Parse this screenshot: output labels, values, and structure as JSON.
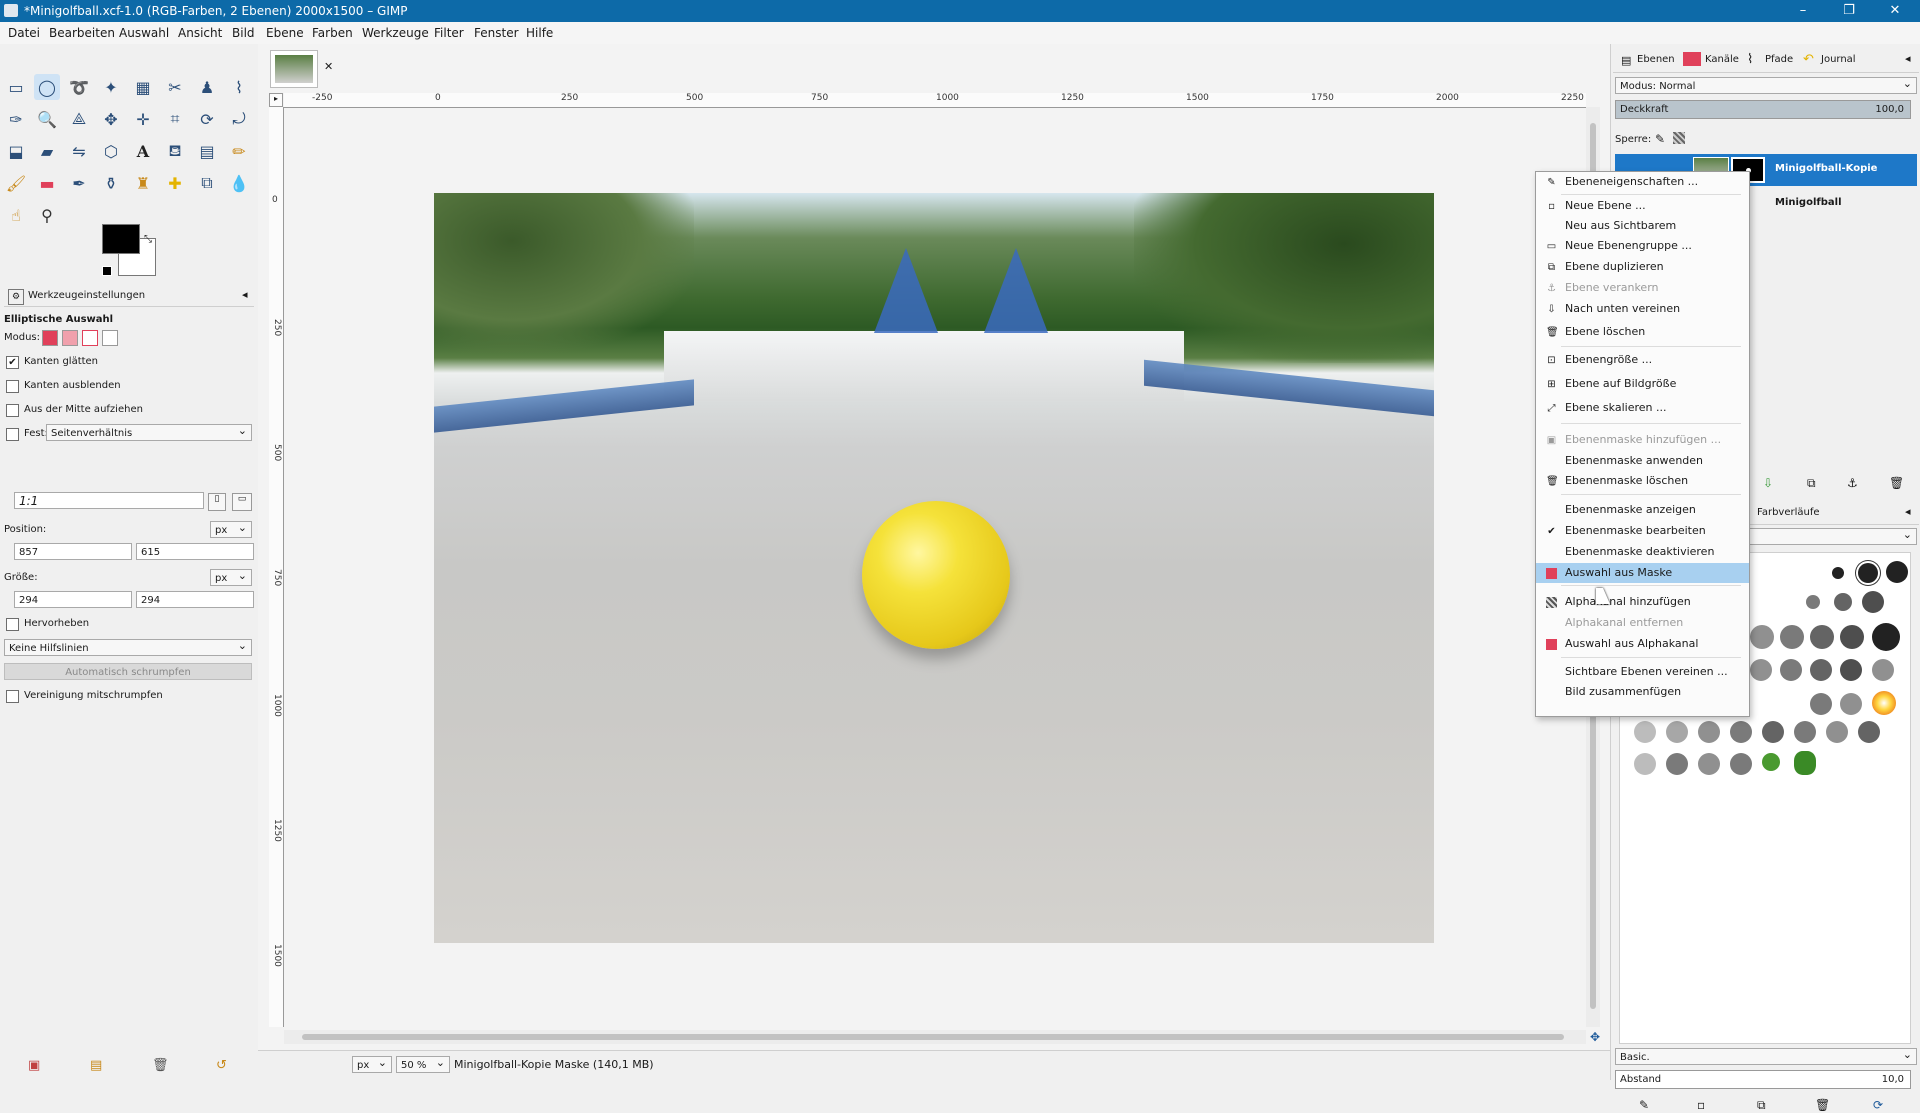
{
  "window": {
    "title": "*Minigolfball.xcf-1.0 (RGB-Farben, 2 Ebenen) 2000x1500 – GIMP",
    "controls": [
      "–",
      "❐",
      "✕"
    ]
  },
  "menubar": [
    "Datei",
    "Bearbeiten",
    "Auswahl",
    "Ansicht",
    "Bild",
    "Ebene",
    "Farben",
    "Werkzeuge",
    "Filter",
    "Fenster",
    "Hilfe"
  ],
  "tool_options": {
    "tab_label": "Werkzeugeinstellungen",
    "tool_name": "Elliptische Auswahl",
    "mode_label": "Modus:",
    "antialias": "Kanten glätten",
    "feather": "Kanten ausblenden",
    "from_center": "Aus der Mitte aufziehen",
    "fixed": "Fest:",
    "fixed_value": "Seitenverhältnis",
    "ratio": "1:1",
    "position_label": "Position:",
    "position_unit": "px",
    "pos_x": "857",
    "pos_y": "615",
    "size_label": "Größe:",
    "size_unit": "px",
    "size_w": "294",
    "size_h": "294",
    "highlight": "Hervorheben",
    "guides": "Keine Hilfslinien",
    "auto_shrink": "Automatisch schrumpfen",
    "shrink_merged": "Vereinigung mitschrumpfen"
  },
  "ruler": {
    "h_ticks": [
      "-250",
      "0",
      "250",
      "500",
      "750",
      "1000",
      "1250",
      "1500",
      "1750",
      "2000",
      "2250"
    ],
    "v_ticks": [
      "0",
      "250",
      "500",
      "750",
      "1000",
      "1250",
      "1500"
    ]
  },
  "statusbar": {
    "unit": "px",
    "zoom": "50 %",
    "message": "Minigolfball-Kopie Maske (140,1 MB)"
  },
  "layers_dock": {
    "tabs": [
      "Ebenen",
      "Kanäle",
      "Pfade",
      "Journal"
    ],
    "mode_label": "Modus: Normal",
    "opacity_label": "Deckkraft",
    "opacity_value": "100,0",
    "lock_label": "Sperre:",
    "layer1": "Minigolfball-Kopie",
    "layer2": "Minigolfball"
  },
  "brushes_dock": {
    "tab_label": "Farbverläufe",
    "preset": "Basic.",
    "spacing_label": "Abstand",
    "spacing_value": "10,0"
  },
  "context_menu": {
    "items": [
      {
        "label": "Ebeneneigenschaften ...",
        "icon": "✎",
        "disabled": false
      },
      {
        "label": "Neue Ebene ...",
        "icon": "▫",
        "disabled": false
      },
      {
        "label": "Neu aus Sichtbarem",
        "icon": "",
        "disabled": false
      },
      {
        "label": "Neue Ebenengruppe ...",
        "icon": "▭",
        "disabled": false
      },
      {
        "label": "Ebene duplizieren",
        "icon": "⧉",
        "disabled": false
      },
      {
        "label": "Ebene verankern",
        "icon": "⚓",
        "disabled": true
      },
      {
        "label": "Nach unten vereinen",
        "icon": "⇩",
        "disabled": false
      },
      {
        "label": "Ebene löschen",
        "icon": "🗑",
        "disabled": false
      },
      {
        "label": "Ebenengröße ...",
        "icon": "⊡",
        "disabled": false
      },
      {
        "label": "Ebene auf Bildgröße",
        "icon": "⊞",
        "disabled": false
      },
      {
        "label": "Ebene skalieren ...",
        "icon": "⤢",
        "disabled": false
      },
      {
        "label": "Ebenenmaske hinzufügen ...",
        "icon": "▣",
        "disabled": true
      },
      {
        "label": "Ebenenmaske anwenden",
        "icon": "",
        "disabled": false
      },
      {
        "label": "Ebenenmaske löschen",
        "icon": "🗑",
        "disabled": false
      },
      {
        "label": "Ebenenmaske anzeigen",
        "icon": "",
        "disabled": false
      },
      {
        "label": "Ebenenmaske bearbeiten",
        "icon": "✔",
        "disabled": false
      },
      {
        "label": "Ebenenmaske deaktivieren",
        "icon": "",
        "disabled": false
      },
      {
        "label": "Auswahl aus Maske",
        "icon": "■",
        "disabled": false,
        "highlighted": true
      },
      {
        "label": "Alphakanal hinzufügen",
        "icon": "▩",
        "disabled": false
      },
      {
        "label": "Alphakanal entfernen",
        "icon": "",
        "disabled": true
      },
      {
        "label": "Auswahl aus Alphakanal",
        "icon": "■",
        "disabled": false
      },
      {
        "label": "Sichtbare Ebenen vereinen ...",
        "icon": "",
        "disabled": false
      },
      {
        "label": "Bild zusammenfügen",
        "icon": "",
        "disabled": false
      }
    ]
  },
  "colors": {
    "titlebar": "#0d6aa8",
    "highlight": "#a8d0f0",
    "selected_layer": "#1e78c8",
    "red_icon": "#e0405a"
  }
}
